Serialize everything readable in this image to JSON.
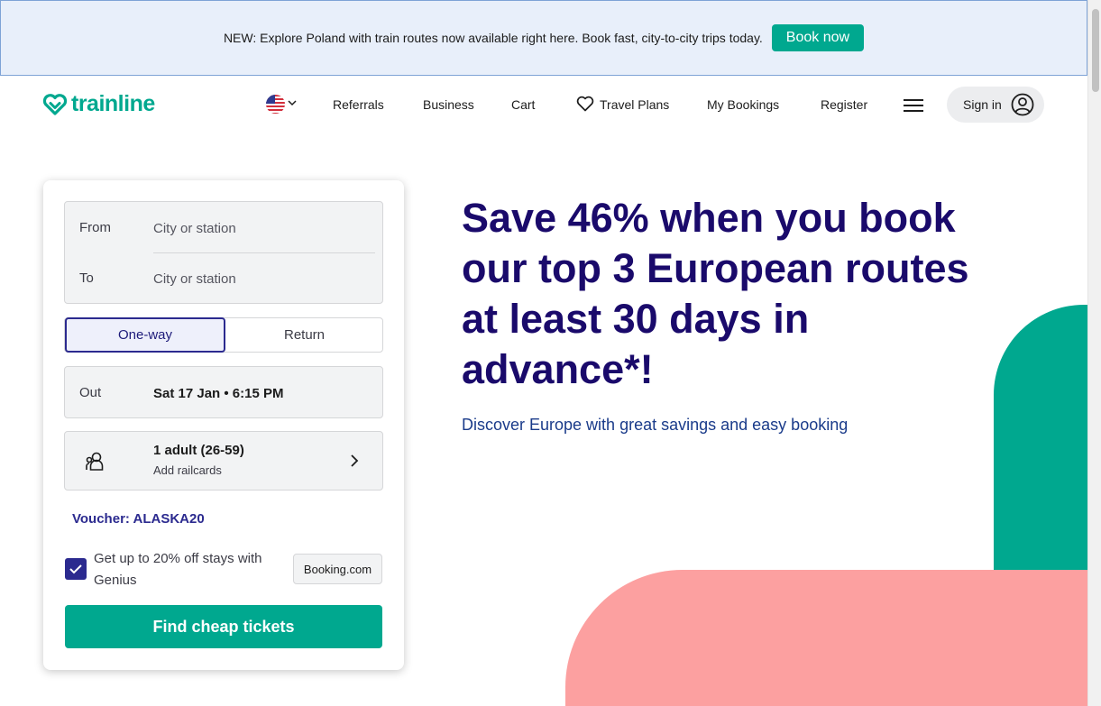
{
  "banner": {
    "text": "NEW: Explore Poland with train routes now available right here. Book fast, city-to-city trips today.",
    "button_label": "Book now"
  },
  "header": {
    "logo_text": "trainline",
    "nav": {
      "referrals": "Referrals",
      "business": "Business",
      "cart": "Cart",
      "travel_plans": "Travel Plans",
      "my_bookings": "My Bookings",
      "register": "Register"
    },
    "sign_in": "Sign in"
  },
  "search": {
    "from_label": "From",
    "from_placeholder": "City or station",
    "to_label": "To",
    "to_placeholder": "City or station",
    "trip_types": [
      "One-way",
      "Return"
    ],
    "selected_trip_type": "One-way",
    "out_label": "Out",
    "out_value": "Sat 17 Jan • 6:15 PM",
    "passengers": "1 adult (26-59)",
    "railcards": "Add railcards",
    "voucher": "Voucher: ALASKA20",
    "genius_text": "Get up to 20% off stays with Genius",
    "genius_checked": true,
    "booking_badge": "Booking.com",
    "submit_label": "Find cheap tickets"
  },
  "hero": {
    "title": "Save 46% when you book our top 3 European routes at least 30 days in advance*!",
    "subtitle": "Discover Europe with great savings and easy booking"
  },
  "colors": {
    "brand_green": "#00a88f",
    "navy": "#1a0a6b",
    "accent_blue": "#2b2a8f",
    "pink": "#fca0a0",
    "banner_bg": "#e8effa"
  }
}
